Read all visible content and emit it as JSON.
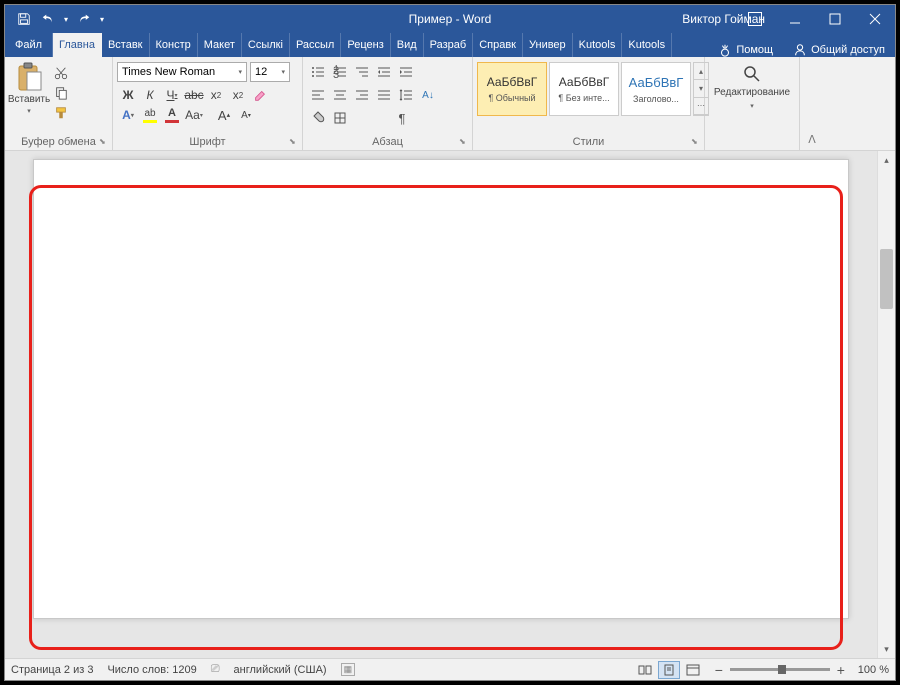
{
  "titlebar": {
    "title": "Пример  -  Word",
    "user": "Виктор Гойман"
  },
  "tabs": {
    "file": "Файл",
    "home": "Главна",
    "insert": "Вставк",
    "design": "Констр",
    "layout": "Макет",
    "references": "Ссылкі",
    "mailings": "Рассыл",
    "review": "Реценз",
    "view": "Вид",
    "developer": "Разраб",
    "help": "Справк",
    "univer": "Универ",
    "kutools1": "Kutools",
    "kutools2": "Kutools",
    "tell_me": "Помощ",
    "share": "Общий доступ"
  },
  "ribbon": {
    "clipboard": {
      "label": "Буфер обмена",
      "paste": "Вставить"
    },
    "font": {
      "label": "Шрифт",
      "name": "Times New Roman",
      "size": "12"
    },
    "paragraph": {
      "label": "Абзац"
    },
    "styles": {
      "label": "Стили",
      "preview": "АаБбВвГ",
      "normal": "¶ Обычный",
      "nospace": "¶ Без инте...",
      "heading1": "Заголово..."
    },
    "editing": {
      "label": "Редактирование"
    }
  },
  "statusbar": {
    "page": "Страница 2 из 3",
    "words": "Число слов: 1209",
    "lang": "английский (США)",
    "zoom": "100 %"
  }
}
